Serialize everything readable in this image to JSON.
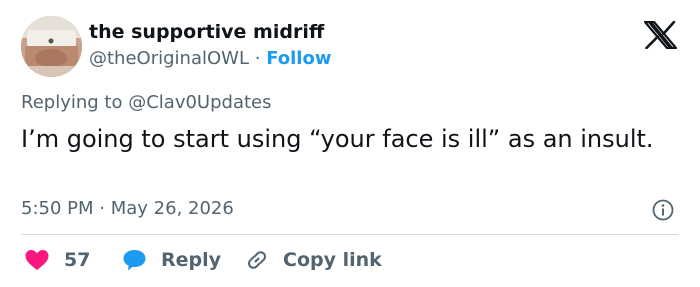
{
  "author": {
    "display_name": "the supportive midriff",
    "handle": "@theOriginalOWL",
    "separator": "·",
    "follow_label": "Follow"
  },
  "tweet": {
    "replying_prefix": "Replying to",
    "replying_to": "@Clav0Updates",
    "text": "I’m going to start using “your face is ill” as an insult.",
    "time": "5:50 PM",
    "date": "May 26, 2026",
    "time_separator": "·"
  },
  "actions": {
    "like_count": "57",
    "reply_label": "Reply",
    "copy_link_label": "Copy link"
  },
  "colors": {
    "text_primary": "#0f1419",
    "text_secondary": "#536471",
    "link_blue": "#1d9bf0",
    "like_red": "#f91880",
    "reply_blue": "#1d9bf0",
    "divider": "#cfd9de"
  },
  "icons": {
    "logo": "x-logo-icon",
    "info": "info-icon",
    "like": "heart-icon",
    "reply": "speech-bubble-icon",
    "copy": "link-icon"
  }
}
